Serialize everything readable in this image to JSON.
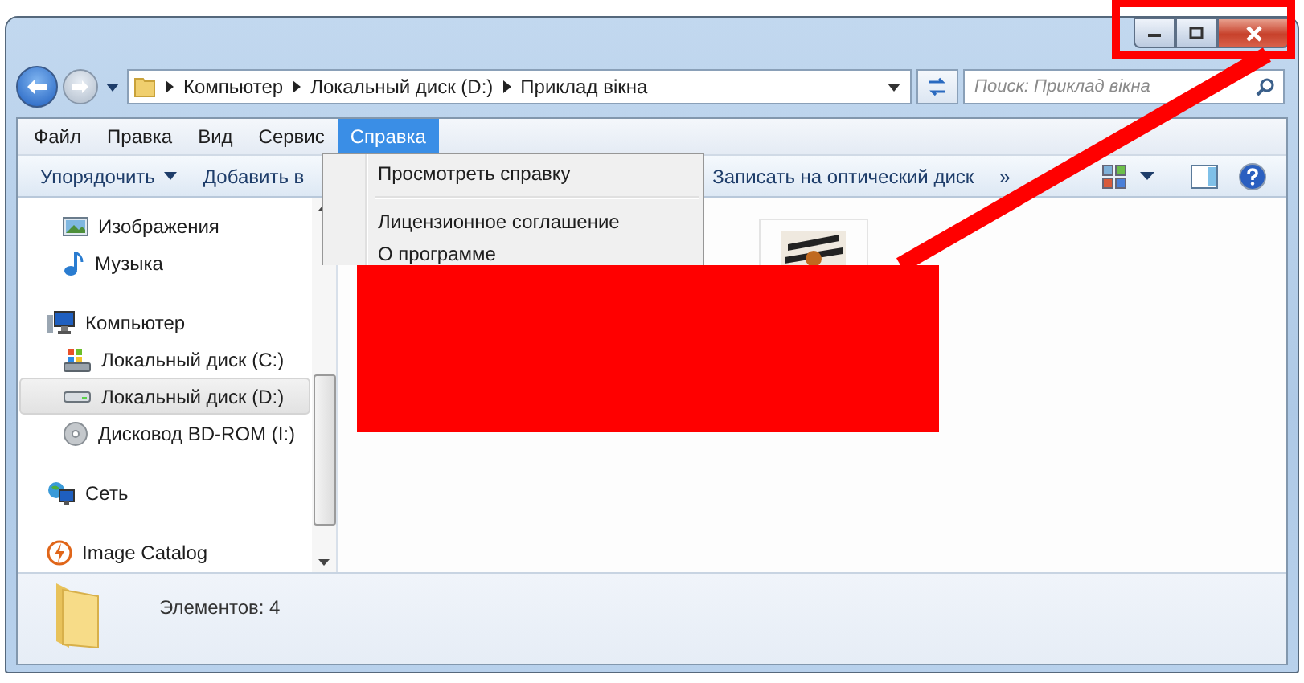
{
  "address": {
    "breadcrumbs": [
      "Компьютер",
      "Локальный диск (D:)",
      "Приклад вікна"
    ]
  },
  "search": {
    "placeholder": "Поиск: Приклад вікна"
  },
  "menu_bar": [
    {
      "label": "Файл",
      "selected": false
    },
    {
      "label": "Правка",
      "selected": false
    },
    {
      "label": "Вид",
      "selected": false
    },
    {
      "label": "Сервис",
      "selected": false
    },
    {
      "label": "Справка",
      "selected": true
    }
  ],
  "menu_dropdown": [
    {
      "kind": "item",
      "label": "Просмотреть справку"
    },
    {
      "kind": "separator"
    },
    {
      "kind": "item",
      "label": "Лицензионное соглашение"
    },
    {
      "kind": "item",
      "label": "О программе"
    }
  ],
  "toolbar": [
    {
      "label": "Упорядочить",
      "dropdown": true
    },
    {
      "label": "Добавить в",
      "dropdown": false
    },
    {
      "label": "Записать на оптический диск",
      "dropdown": false
    },
    {
      "label": "»",
      "dropdown": false
    }
  ],
  "nav": {
    "continued_children": [
      {
        "label": "Изображения",
        "kind": "pictures",
        "selected": false
      },
      {
        "label": "Музыка",
        "kind": "music",
        "selected": false
      }
    ],
    "tree": [
      {
        "label": "Компьютер",
        "kind": "computer",
        "selected": false,
        "children": [
          {
            "label": "Локальный диск (C:)",
            "kind": "system-drive",
            "selected": false
          },
          {
            "label": "Локальный диск (D:)",
            "kind": "drive",
            "selected": true
          },
          {
            "label": "Дисковод BD-ROM (I:)",
            "kind": "optical-drive",
            "selected": false
          }
        ]
      },
      {
        "label": "Сеть",
        "kind": "network",
        "selected": false
      },
      {
        "label": "Image Catalog",
        "kind": "app",
        "selected": false
      }
    ]
  },
  "status_bar": {
    "item_count": "Элементов: 4"
  }
}
